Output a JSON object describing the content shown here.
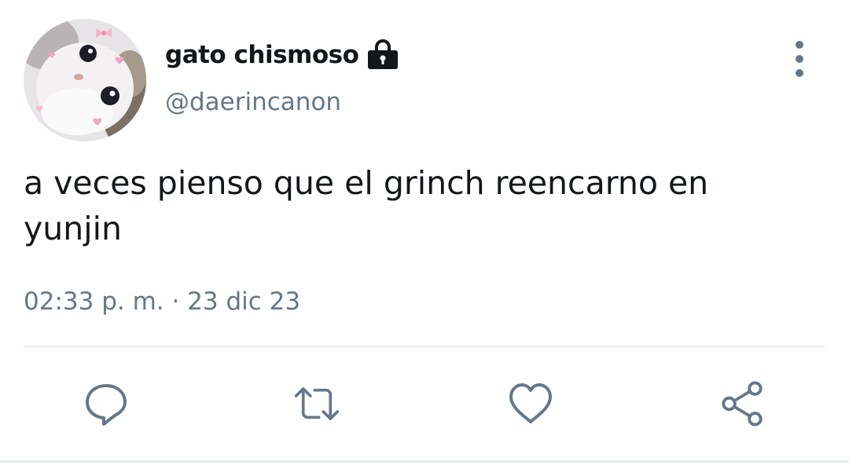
{
  "user": {
    "display_name": "gato chismoso",
    "handle": "@daerincanon",
    "protected_icon": "lock-icon",
    "avatar": "cat-avatar"
  },
  "tweet": {
    "text": "a veces pienso que el grinch reencarno en\nyunjin",
    "timestamp": "02:33 p. m. · 23 dic 23"
  },
  "actions": [
    {
      "name": "reply",
      "icon": "speech-bubble-icon"
    },
    {
      "name": "retweet",
      "icon": "retweet-icon"
    },
    {
      "name": "like",
      "icon": "heart-icon"
    },
    {
      "name": "share",
      "icon": "share-icon"
    }
  ],
  "colors": {
    "text": "#14171a",
    "secondary": "#657786",
    "divider": "#e6ecf0",
    "icon": "#657786"
  }
}
